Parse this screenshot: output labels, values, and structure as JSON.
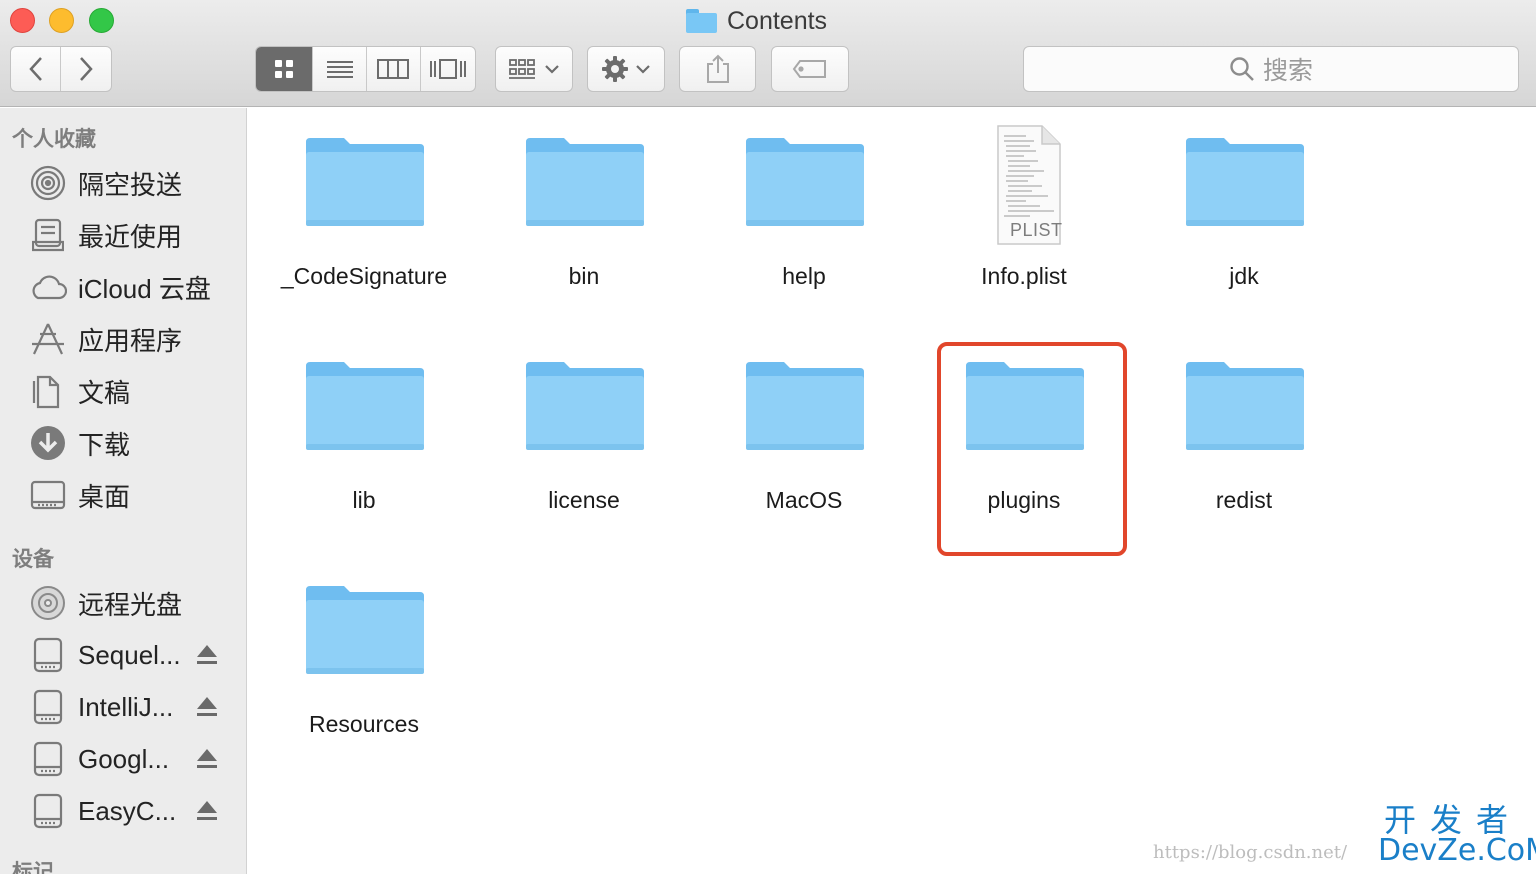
{
  "window": {
    "title": "Contents"
  },
  "toolbar": {
    "search_placeholder": "搜索",
    "view_modes": [
      "icon-view",
      "list-view",
      "column-view",
      "cover-flow-view"
    ],
    "active_view": "icon-view"
  },
  "sidebar": {
    "favorites_header": "个人收藏",
    "favorites": [
      {
        "label": "隔空投送",
        "icon": "airdrop-icon"
      },
      {
        "label": "最近使用",
        "icon": "recents-icon"
      },
      {
        "label": "iCloud 云盘",
        "icon": "icloud-icon"
      },
      {
        "label": "应用程序",
        "icon": "applications-icon"
      },
      {
        "label": "文稿",
        "icon": "documents-icon"
      },
      {
        "label": "下载",
        "icon": "downloads-icon"
      },
      {
        "label": "桌面",
        "icon": "desktop-icon"
      }
    ],
    "devices_header": "设备",
    "devices": [
      {
        "label": "远程光盘",
        "icon": "remote-disc-icon",
        "eject": false
      },
      {
        "label": "Sequel...",
        "icon": "drive-icon",
        "eject": true
      },
      {
        "label": "IntelliJ...",
        "icon": "drive-icon",
        "eject": true
      },
      {
        "label": "Googl...",
        "icon": "drive-icon",
        "eject": true
      },
      {
        "label": "EasyC...",
        "icon": "drive-icon",
        "eject": true
      }
    ],
    "tags_header": "标记"
  },
  "files": [
    {
      "name": "_CodeSignature",
      "kind": "folder"
    },
    {
      "name": "bin",
      "kind": "folder"
    },
    {
      "name": "help",
      "kind": "folder"
    },
    {
      "name": "Info.plist",
      "kind": "plist",
      "badge": "PLIST"
    },
    {
      "name": "jdk",
      "kind": "folder"
    },
    {
      "name": "lib",
      "kind": "folder"
    },
    {
      "name": "license",
      "kind": "folder"
    },
    {
      "name": "MacOS",
      "kind": "folder"
    },
    {
      "name": "plugins",
      "kind": "folder",
      "highlighted": true
    },
    {
      "name": "redist",
      "kind": "folder"
    },
    {
      "name": "Resources",
      "kind": "folder"
    }
  ],
  "colors": {
    "highlight": "#e1462b",
    "folder": "#8fd0f7"
  },
  "watermark": {
    "url": "https://blog.csdn.net/",
    "cn": "开发者",
    "en": "DevZe.CoM"
  }
}
